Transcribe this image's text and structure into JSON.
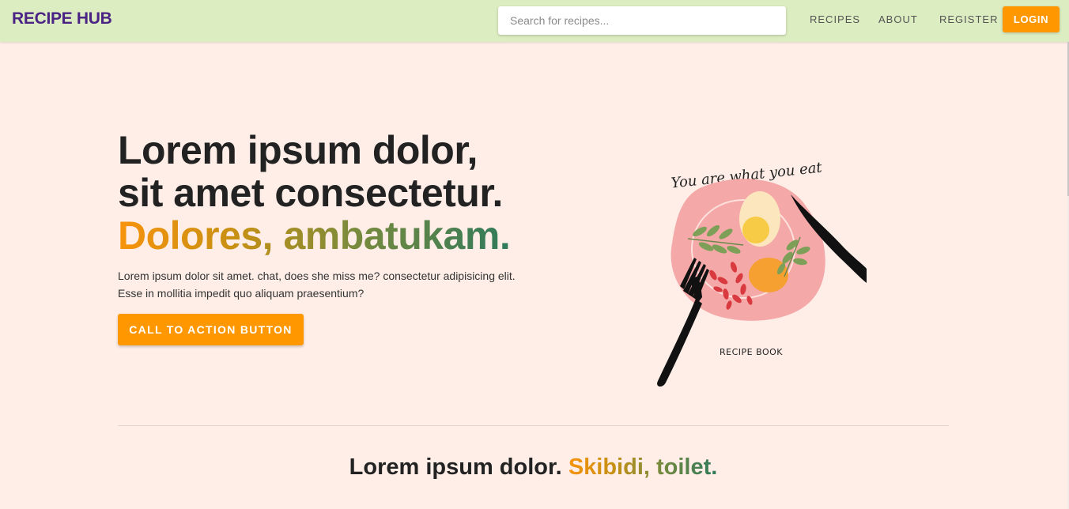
{
  "navbar": {
    "brand": "RECIPE HUB",
    "search_placeholder": "Search for recipes...",
    "links": [
      "RECIPES",
      "ABOUT",
      "REGISTER"
    ],
    "login_label": "LOGIN"
  },
  "hero": {
    "title_line1": "Lorem ipsum dolor,",
    "title_line2": "sit amet consectetur.",
    "title_line3": "Dolores, ambatukam.",
    "description": "Lorem ipsum dolor sit amet. chat, does she miss me? consectetur adipisicing elit. Esse in mollitia impedit quo aliquam praesentium?",
    "cta_label": "CALL TO ACTION BUTTON",
    "illustration": {
      "caption_top": "You are what you eat",
      "caption_bottom": "RECIPE BOOK"
    }
  },
  "section": {
    "title_plain": "Lorem ipsum dolor.",
    "title_highlight": "Skibidi, toilet."
  },
  "colors": {
    "navbar_bg": "#dcedc1",
    "brand": "#4a2384",
    "accent": "#ff9800",
    "page_bg": "#ffeee7",
    "gradient_start": "#f7930c",
    "gradient_end": "#2f7a5c"
  }
}
